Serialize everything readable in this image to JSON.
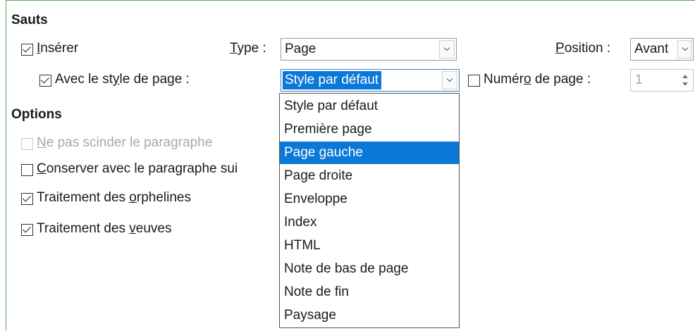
{
  "sections": {
    "breaks_heading": "Sauts",
    "options_heading": "Options"
  },
  "breaks": {
    "insert": {
      "label_pre": "",
      "label_mn": "I",
      "label_post": "nsérer",
      "checked": true
    },
    "type": {
      "label_pre": "",
      "label_mn": "T",
      "label_post": "ype :",
      "value": "Page"
    },
    "position": {
      "label_pre": "",
      "label_mn": "P",
      "label_post": "osition :",
      "value": "Avant"
    },
    "with_page_style": {
      "label_pre": "Avec le st",
      "label_mn": "y",
      "label_post": "le de page :",
      "checked": true,
      "value": "Style par défaut"
    },
    "page_number": {
      "label_pre": "Numér",
      "label_mn": "o",
      "label_post": " de page :",
      "checked": false,
      "value": "1"
    }
  },
  "options": {
    "keep_paragraph": {
      "label_pre": "",
      "label_mn": "N",
      "label_post": "e pas scinder le paragraphe",
      "checked": false,
      "disabled": true
    },
    "keep_with_next": {
      "label_pre": "",
      "label_mn": "C",
      "label_post": "onserver avec le paragraphe sui",
      "checked": false
    },
    "orphans": {
      "label_pre": "Traitement des ",
      "label_mn": "o",
      "label_post": "rphelines",
      "checked": true
    },
    "widows": {
      "label_pre": "Traitement des ",
      "label_mn": "v",
      "label_post": "euves",
      "checked": true
    }
  },
  "page_style_dropdown": {
    "items": [
      "Style par défaut",
      "Première page",
      "Page gauche",
      "Page droite",
      "Enveloppe",
      "Index",
      "HTML",
      "Note de bas de page",
      "Note de fin",
      "Paysage"
    ],
    "highlighted": "Page gauche"
  }
}
